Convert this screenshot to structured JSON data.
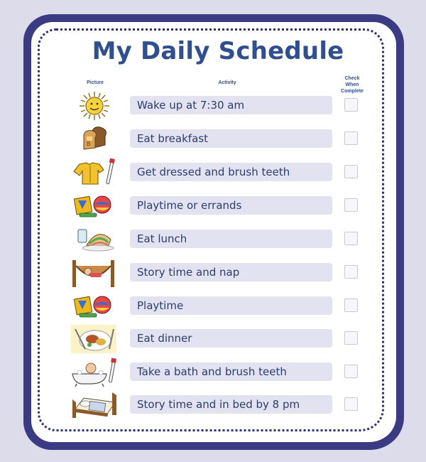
{
  "title": "My Daily Schedule",
  "columns": {
    "picture": "Picture",
    "activity": "Activity",
    "check_line1": "Check",
    "check_line2": "When",
    "check_line3": "Complete"
  },
  "activities": [
    {
      "label": "Wake up at 7:30 am",
      "icon": "sun-icon",
      "checked": false
    },
    {
      "label": "Eat breakfast",
      "icon": "toast-icon",
      "checked": false
    },
    {
      "label": "Get dressed and brush teeth",
      "icon": "shirt-toothbrush-icon",
      "checked": false
    },
    {
      "label": "Playtime or errands",
      "icon": "toys-icon",
      "checked": false
    },
    {
      "label": "Eat lunch",
      "icon": "sandwich-icon",
      "checked": false
    },
    {
      "label": "Story time and nap",
      "icon": "hammock-icon",
      "checked": false
    },
    {
      "label": "Playtime",
      "icon": "toys-icon",
      "checked": false
    },
    {
      "label": "Eat dinner",
      "icon": "dinner-plate-icon",
      "checked": false
    },
    {
      "label": "Take a bath and brush teeth",
      "icon": "bathtub-icon",
      "checked": false
    },
    {
      "label": "Story time and in bed by 8 pm",
      "icon": "bed-icon",
      "checked": false
    }
  ],
  "colors": {
    "frame": "#3a3b82",
    "title": "#2f4f8f",
    "activity_bg": "#e2e2f0",
    "background": "#dcdceb"
  }
}
